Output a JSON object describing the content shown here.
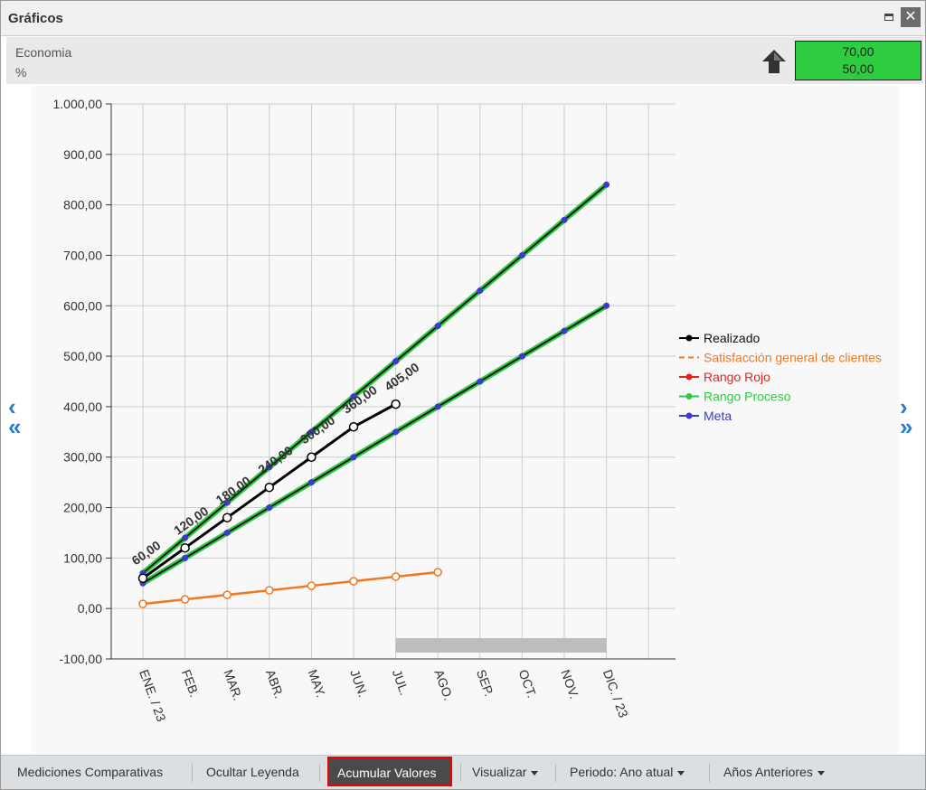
{
  "window": {
    "title": "Gráficos"
  },
  "indicator": {
    "name": "Economia",
    "unit": "%",
    "value_top": "70,00",
    "value_bottom": "50,00",
    "box_color": "#2ecc40"
  },
  "toolbar": {
    "comparative": "Mediciones Comparativas",
    "hide_legend": "Ocultar Leyenda",
    "accumulate": "Acumular Valores",
    "view": "Visualizar",
    "period": "Periodo: Ano atual",
    "previous_years": "Años Anteriores"
  },
  "nav": {
    "prev": "‹",
    "first": "«",
    "next": "›",
    "last": "»"
  },
  "chart_data": {
    "type": "line",
    "categories": [
      "ENE. / 23",
      "FEB.",
      "MAR.",
      "ABR.",
      "MAY.",
      "JUN.",
      "JUL.",
      "AGO.",
      "SEP.",
      "OCT.",
      "NOV.",
      "DIC. / 23"
    ],
    "ylim": [
      -100,
      1000
    ],
    "ytick_step": 100,
    "ytick_labels": [
      "-100,00",
      "0,00",
      "100,00",
      "200,00",
      "300,00",
      "400,00",
      "500,00",
      "600,00",
      "700,00",
      "800,00",
      "900,00",
      "1.000,00"
    ],
    "grid": true,
    "legend_position": "right",
    "series": [
      {
        "name": "Realizado",
        "color": "#000000",
        "values": [
          60,
          120,
          180,
          240,
          300,
          360,
          405
        ],
        "labels": [
          "60,00",
          "120,00",
          "180,00",
          "240,00",
          "300,00",
          "360,00",
          "405,00"
        ]
      },
      {
        "name": "Satisfacción general de clientes",
        "color": "#f07820",
        "dashed": true,
        "values": [
          9,
          18,
          27,
          36,
          45,
          54,
          63,
          72
        ]
      },
      {
        "name": "Rango Rojo",
        "color": "#e8201c",
        "values": []
      },
      {
        "name": "Rango Proceso",
        "color": "#2ecc40",
        "values": [
          70,
          140,
          210,
          280,
          350,
          420,
          490,
          560,
          630,
          700,
          770,
          840
        ]
      },
      {
        "name": "Meta",
        "color": "#3a3ad0",
        "values": [
          50,
          100,
          150,
          200,
          250,
          300,
          350,
          400,
          450,
          500,
          550,
          600
        ]
      }
    ]
  }
}
